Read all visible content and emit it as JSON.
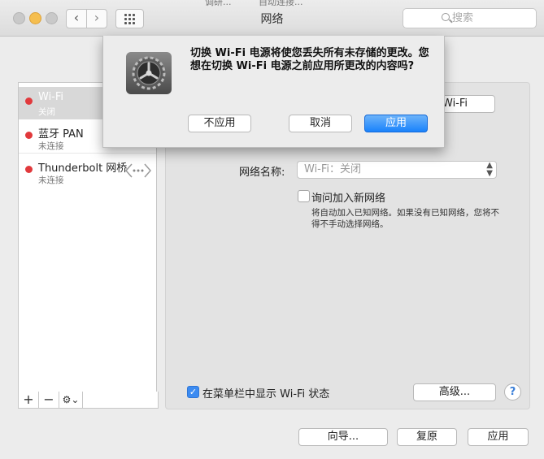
{
  "window": {
    "title": "网络",
    "search_placeholder": "搜索",
    "behind_text_1": "调研...",
    "behind_text_2": "自动连接..."
  },
  "sidebar": {
    "services": [
      {
        "name": "Wi-Fi",
        "status": "关闭",
        "color": "#e1393c"
      },
      {
        "name": "蓝牙 PAN",
        "status": "未连接",
        "color": "#e1393c"
      },
      {
        "name": "Thunderbolt 网桥",
        "status": "未连接",
        "color": "#e1393c"
      }
    ],
    "add_label": "+",
    "remove_label": "−",
    "gear_label": "⚙︎⌄"
  },
  "main": {
    "wifi_button": "Wi-Fi",
    "network_name_label": "网络名称:",
    "network_name_value": "Wi-Fi：关闭",
    "ask_join_label": "询问加入新网络",
    "ask_join_desc": "将自动加入已知网络。如果没有已知网络，您将不得不手动选择网络。",
    "menubar_label": "在菜单栏中显示 Wi-Fi 状态",
    "advanced_button": "高级...",
    "help_label": "?"
  },
  "bottom": {
    "assist_button": "向导...",
    "revert_button": "复原",
    "apply_button": "应用"
  },
  "alert": {
    "message": "切换 Wi-Fi 电源将使您丢失所有未存储的更改。您想在切换 Wi-Fi 电源之前应用所更改的内容吗?",
    "dont_apply": "不应用",
    "cancel": "取消",
    "apply": "应用"
  },
  "colors": {
    "accent": "#1a82fb",
    "status_off": "#e1393c"
  }
}
